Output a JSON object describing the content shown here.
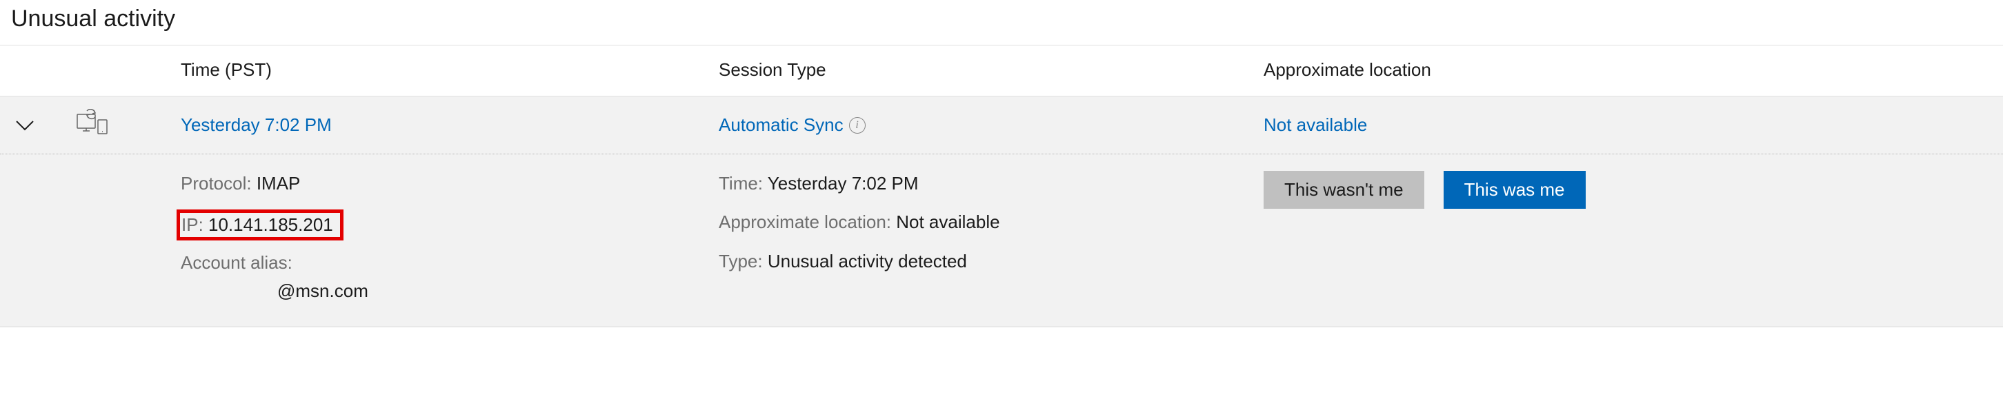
{
  "page_title": "Unusual activity",
  "columns": {
    "time": "Time (PST)",
    "session": "Session Type",
    "location": "Approximate location"
  },
  "row": {
    "time": "Yesterday 7:02 PM",
    "session": "Automatic Sync",
    "location": "Not available"
  },
  "details": {
    "protocol_label": "Protocol: ",
    "protocol_value": "IMAP",
    "ip_label": "IP: ",
    "ip_value": "10.141.185.201",
    "alias_label": "Account alias:",
    "alias_value": "@msn.com",
    "time_label": "Time: ",
    "time_value": "Yesterday 7:02 PM",
    "approx_label": "Approximate location: ",
    "approx_value": "Not available",
    "type_label": "Type: ",
    "type_value": "Unusual activity detected"
  },
  "buttons": {
    "not_me": "This wasn't me",
    "was_me": "This was me"
  }
}
